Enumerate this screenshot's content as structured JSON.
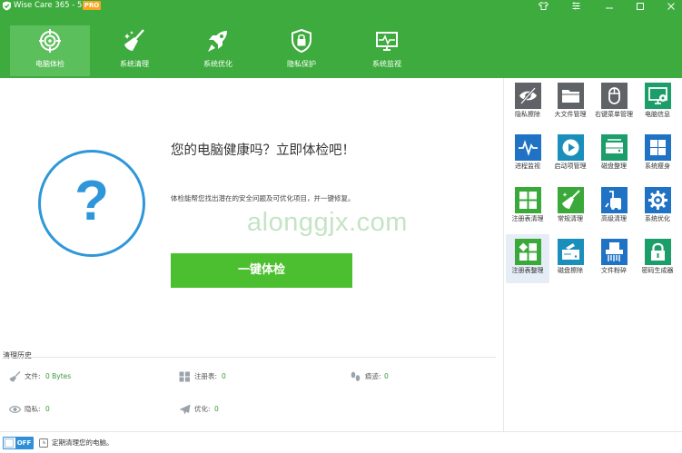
{
  "window": {
    "title": "Wise Care 365 - 5.8.3",
    "badge": "PRO",
    "controls": [
      "shirt-icon",
      "menu-icon",
      "minimize-icon",
      "maximize-icon",
      "close-icon"
    ]
  },
  "nav": {
    "active": "tab-checkup",
    "tabs": [
      {
        "label": "电脑体检",
        "icon": "target-icon"
      },
      {
        "label": "系统清理",
        "icon": "broom-icon"
      },
      {
        "label": "系统优化",
        "icon": "rocket-icon"
      },
      {
        "label": "隐私保护",
        "icon": "lock-shield-icon"
      },
      {
        "label": "系统监视",
        "icon": "monitor-pulse-icon"
      }
    ]
  },
  "main": {
    "status_symbol": "?",
    "title": "您的电脑健康吗？立即体检吧！",
    "description": "体检能帮您找出潜在的安全问题及可优化项目，并一键修复。",
    "scan_button": "一键体检",
    "watermark": "alonggjx.com"
  },
  "history": {
    "heading": "清理历史",
    "items": [
      {
        "label": "文件:",
        "value": "0 Bytes",
        "icon": "broom-small-icon"
      },
      {
        "label": "注册表:",
        "value": "0",
        "icon": "grid-small-icon"
      },
      {
        "label": "痕迹:",
        "value": "0",
        "icon": "footprint-icon"
      },
      {
        "label": "隐私:",
        "value": "0",
        "icon": "eye-icon"
      },
      {
        "label": "优化:",
        "value": "0",
        "icon": "plane-icon"
      }
    ]
  },
  "tools": [
    {
      "label": "隐私擦除",
      "icon": "eye-slash-icon",
      "color": "#5f6266"
    },
    {
      "label": "大文件管理",
      "icon": "folder-icon",
      "color": "#5f6266"
    },
    {
      "label": "右键菜单管理",
      "icon": "mouse-icon",
      "color": "#5f6266"
    },
    {
      "label": "电脑信息",
      "icon": "pc-info-icon",
      "color": "#1b9e69"
    },
    {
      "label": "进程监视",
      "icon": "pulse-icon",
      "color": "#1f72c4"
    },
    {
      "label": "启动项管理",
      "icon": "play-icon",
      "color": "#1b8fbb"
    },
    {
      "label": "磁盘整理",
      "icon": "disk-icon",
      "color": "#1b9e69"
    },
    {
      "label": "系统瘦身",
      "icon": "windows-icon",
      "color": "#1f72c4"
    },
    {
      "label": "注册表清理",
      "icon": "registry-icon",
      "color": "#3aa93a"
    },
    {
      "label": "常规清理",
      "icon": "broom-tool-icon",
      "color": "#3aa93a"
    },
    {
      "label": "高级清理",
      "icon": "vacuum-icon",
      "color": "#1f72c4"
    },
    {
      "label": "系统优化",
      "icon": "gear-icon",
      "color": "#1f72c4"
    },
    {
      "label": "注册表整理",
      "icon": "registry-defrag-icon",
      "color": "#3aa93a"
    },
    {
      "label": "磁盘擦除",
      "icon": "disk-erase-icon",
      "color": "#1b8fbb"
    },
    {
      "label": "文件粉碎",
      "icon": "shredder-icon",
      "color": "#1f72c4"
    },
    {
      "label": "密码生成器",
      "icon": "padlock-icon",
      "color": "#1b9e69"
    }
  ],
  "footer": {
    "toggle_state": "OFF",
    "text": "定期清理您的电脑。",
    "icon": "clock-icon"
  }
}
